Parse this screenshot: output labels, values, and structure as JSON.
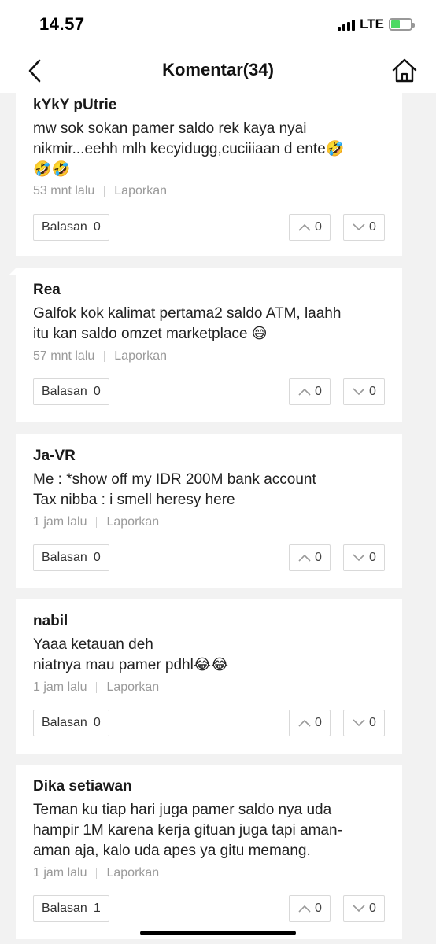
{
  "status_bar": {
    "time": "14.57",
    "network": "LTE",
    "icons": [
      "signal-icon",
      "battery-charging-icon"
    ]
  },
  "nav": {
    "title": "Komentar(34)",
    "icons": [
      "back-chevron-icon",
      "home-icon"
    ]
  },
  "reply_label": "Balasan",
  "comments": [
    {
      "author": "kYkY pUtrie",
      "text": "mw sok sokan pamer saldo rek kaya nyai\nnikmir...eehh mlh kecyidugg,cuciiiaan d ente🤣\n🤣🤣",
      "time": "53 mnt lalu",
      "report": "Laporkan",
      "replies": "0",
      "upvotes": "0",
      "downvotes": "0"
    },
    {
      "author": "Rea",
      "text": "Galfok kok kalimat pertama2 saldo ATM, laahh\nitu kan saldo omzet marketplace 😅",
      "time": "57 mnt lalu",
      "report": "Laporkan",
      "replies": "0",
      "upvotes": "0",
      "downvotes": "0"
    },
    {
      "author": "Ja-VR",
      "text": "Me : *show off my IDR 200M bank account\nTax nibba : i smell heresy here",
      "time": "1 jam lalu",
      "report": "Laporkan",
      "replies": "0",
      "upvotes": "0",
      "downvotes": "0"
    },
    {
      "author": "nabil",
      "text": "Yaaa ketauan deh\nniatnya mau pamer pdhl😂😂",
      "time": "1 jam lalu",
      "report": "Laporkan",
      "replies": "0",
      "upvotes": "0",
      "downvotes": "0"
    },
    {
      "author": "Dika setiawan",
      "text": "Teman ku tiap hari juga pamer saldo nya uda\nhampir 1M karena kerja gituan juga tapi aman-\naman aja, kalo uda apes ya gitu memang.",
      "time": "1 jam lalu",
      "report": "Laporkan",
      "replies": "1",
      "upvotes": "0",
      "downvotes": "0"
    }
  ],
  "colors": {
    "background": "#f2f2f2",
    "card": "#ffffff",
    "muted_text": "#9a9a9a",
    "border": "#d9d9d9",
    "battery": "#4cd964"
  }
}
